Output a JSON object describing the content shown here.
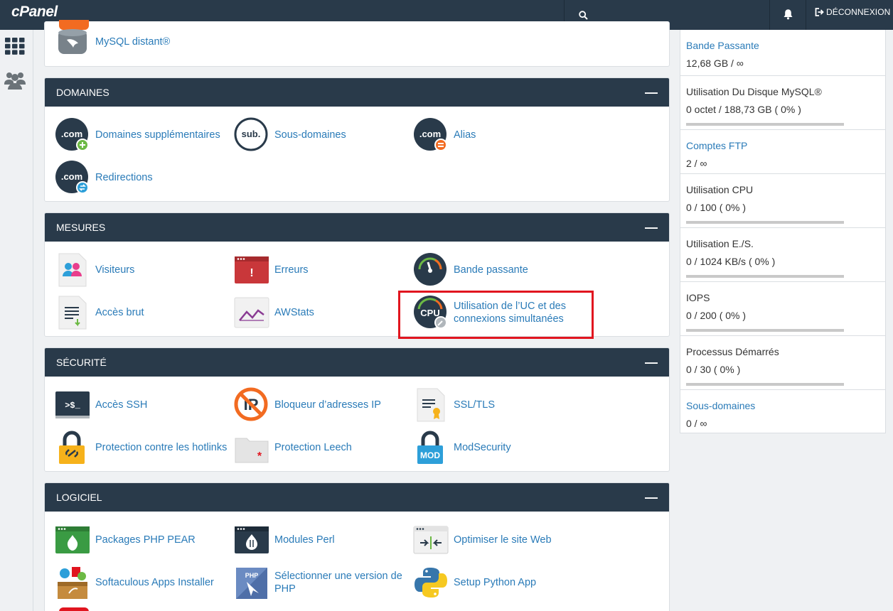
{
  "header": {
    "logo": "cPanel",
    "search_icon": "search-icon",
    "bell_icon": "bell-icon",
    "logout_label": "DÉCONNEXION"
  },
  "sidebar": {
    "items": [
      {
        "icon": "grid-icon"
      },
      {
        "icon": "users-icon"
      }
    ]
  },
  "top_partial": {
    "item": {
      "label": "MySQL distant®",
      "icon": "mysql-remote-icon"
    }
  },
  "sections": [
    {
      "title": "DOMAINES",
      "items": [
        {
          "label": "Domaines supplémentaires",
          "icon": "addon-domains-icon",
          "badge_color": "#6cb944"
        },
        {
          "label": "Sous-domaines",
          "icon": "subdomains-icon"
        },
        {
          "label": "Alias",
          "icon": "aliases-icon",
          "badge_color": "#f26b21"
        },
        {
          "label": "Redirections",
          "icon": "redirects-icon",
          "badge_color": "#2d9fd9"
        }
      ]
    },
    {
      "title": "MESURES",
      "items": [
        {
          "label": "Visiteurs",
          "icon": "visitors-icon"
        },
        {
          "label": "Erreurs",
          "icon": "errors-icon"
        },
        {
          "label": "Bande passante",
          "icon": "bandwidth-icon"
        },
        {
          "label": "Accès brut",
          "icon": "raw-access-icon"
        },
        {
          "label": "AWStats",
          "icon": "awstats-icon"
        },
        {
          "label": "Utilisation de l’UC et des connexions simultanées",
          "icon": "cpu-usage-icon",
          "icon_text": "CPU"
        }
      ]
    },
    {
      "title": "SÉCURITÉ",
      "items": [
        {
          "label": "Accès SSH",
          "icon": "ssh-icon",
          "icon_text": ">$_"
        },
        {
          "label": "Bloqueur d’adresses IP",
          "icon": "ip-blocker-icon"
        },
        {
          "label": "SSL/TLS",
          "icon": "ssl-tls-icon"
        },
        {
          "label": "Protection contre les hotlinks",
          "icon": "hotlink-protection-icon"
        },
        {
          "label": "Protection Leech",
          "icon": "leech-protection-icon"
        },
        {
          "label": "ModSecurity",
          "icon": "modsecurity-icon",
          "icon_text": "MOD"
        }
      ]
    },
    {
      "title": "LOGICIEL",
      "items": [
        {
          "label": "Packages PHP PEAR",
          "icon": "php-pear-icon"
        },
        {
          "label": "Modules Perl",
          "icon": "perl-modules-icon"
        },
        {
          "label": "Optimiser le site Web",
          "icon": "optimize-website-icon"
        },
        {
          "label": "Softaculous Apps Installer",
          "icon": "softaculous-icon"
        },
        {
          "label": "Sélectionner une version de PHP",
          "icon": "php-version-icon",
          "icon_text": "PHP"
        },
        {
          "label": "Setup Python App",
          "icon": "python-app-icon"
        }
      ]
    }
  ],
  "stats": [
    {
      "title": "Bande Passante",
      "value": "12,68 GB / ∞",
      "link": true,
      "usage_fraction": null
    },
    {
      "title": "Utilisation Du Disque MySQL®",
      "value": "0 octet / 188,73 GB ( 0% )",
      "link": false,
      "usage_fraction": 0
    },
    {
      "title": "Comptes FTP",
      "value": "2 / ∞",
      "link": true,
      "usage_fraction": null
    },
    {
      "title": "Utilisation CPU",
      "value": "0 / 100 ( 0% )",
      "link": false,
      "usage_fraction": 0
    },
    {
      "title": "Utilisation E./S.",
      "value": "0 / 1024 KB/s ( 0% )",
      "link": false,
      "usage_fraction": 0
    },
    {
      "title": "IOPS",
      "value": "0 / 200 ( 0% )",
      "link": false,
      "usage_fraction": 0
    },
    {
      "title": "Processus Démarrés",
      "value": "0 / 30 ( 0% )",
      "link": false,
      "usage_fraction": 0
    },
    {
      "title": "Sous-domaines",
      "value": "0 / ∞",
      "link": true,
      "usage_fraction": null
    }
  ],
  "colors": {
    "header_bg": "#293a4a",
    "link": "#2a7bb8",
    "highlight": "#e1151f"
  }
}
